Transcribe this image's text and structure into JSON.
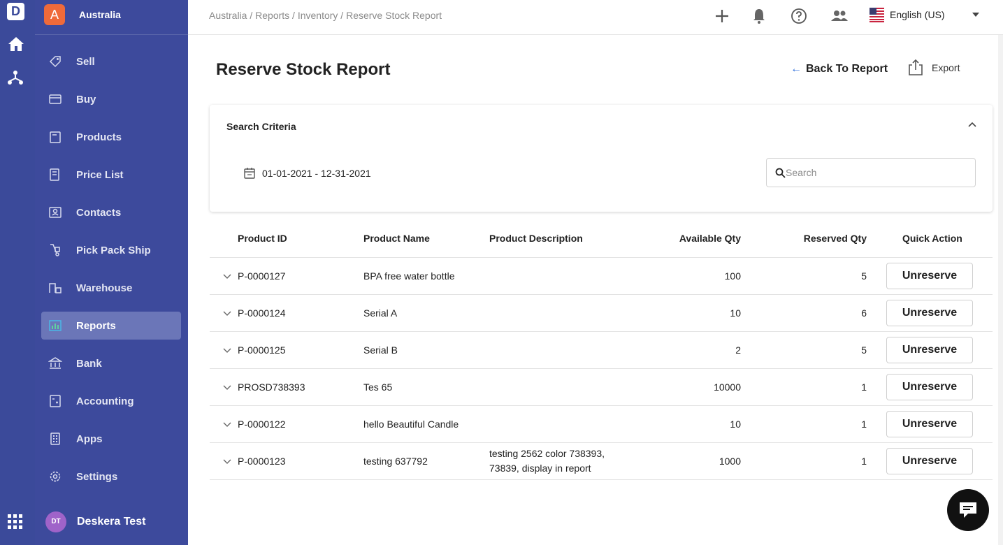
{
  "rail": {
    "logo_letter": "D",
    "icons": [
      "home-icon",
      "org-chart-icon",
      "apps-grid-icon"
    ]
  },
  "sidebar": {
    "tenant_badge": "A",
    "tenant_name": "Australia",
    "items": [
      {
        "label": "Sell",
        "icon": "sell-tag-icon"
      },
      {
        "label": "Buy",
        "icon": "buy-card-icon"
      },
      {
        "label": "Products",
        "icon": "products-box-icon"
      },
      {
        "label": "Price List",
        "icon": "price-list-icon"
      },
      {
        "label": "Contacts",
        "icon": "contacts-icon"
      },
      {
        "label": "Pick Pack Ship",
        "icon": "hand-truck-icon"
      },
      {
        "label": "Warehouse",
        "icon": "warehouse-icon"
      },
      {
        "label": "Reports",
        "icon": "reports-chart-icon",
        "active": true
      },
      {
        "label": "Bank",
        "icon": "bank-icon"
      },
      {
        "label": "Accounting",
        "icon": "accounting-calculator-icon"
      },
      {
        "label": "Apps",
        "icon": "apps-icon"
      },
      {
        "label": "Settings",
        "icon": "settings-gear-icon"
      }
    ],
    "user_initials": "DT",
    "user_name": "Deskera Test"
  },
  "topbar": {
    "breadcrumb": "Australia / Reports / Inventory / Reserve Stock Report",
    "language": "English (US)"
  },
  "header": {
    "title": "Reserve Stock Report",
    "back_arrow": "←",
    "back_label": "Back To Report",
    "export_label": "Export"
  },
  "search_criteria": {
    "title": "Search Criteria",
    "date_range": "01-01-2021 - 12-31-2021",
    "search_placeholder": "Search",
    "search_value": ""
  },
  "table": {
    "headers": {
      "product_id": "Product ID",
      "product_name": "Product Name",
      "description": "Product Description",
      "available_qty": "Available Qty",
      "reserved_qty": "Reserved Qty",
      "quick_action": "Quick Action"
    },
    "action_label": "Unreserve",
    "rows": [
      {
        "id": "P-0000127",
        "name": "BPA free water bottle",
        "description": "",
        "available": "100",
        "reserved": "5"
      },
      {
        "id": "P-0000124",
        "name": "Serial A",
        "description": "",
        "available": "10",
        "reserved": "6"
      },
      {
        "id": "P-0000125",
        "name": "Serial B",
        "description": "",
        "available": "2",
        "reserved": "5"
      },
      {
        "id": "PROSD738393",
        "name": "Tes 65",
        "description": "",
        "available": "10000",
        "reserved": "1"
      },
      {
        "id": "P-0000122",
        "name": "hello Beautiful Candle",
        "description": "",
        "available": "10",
        "reserved": "1"
      },
      {
        "id": "P-0000123",
        "name": "testing 637792",
        "description": "testing 2562 color 738393, 73839, display in report",
        "available": "1000",
        "reserved": "1"
      }
    ]
  },
  "colors": {
    "sidebar": "#3d4a9c",
    "rail": "#3b4a9a",
    "active_item": "#6b76b8",
    "tenant_badge": "#ef6a3a",
    "link_arrow": "#2f6fdc"
  }
}
